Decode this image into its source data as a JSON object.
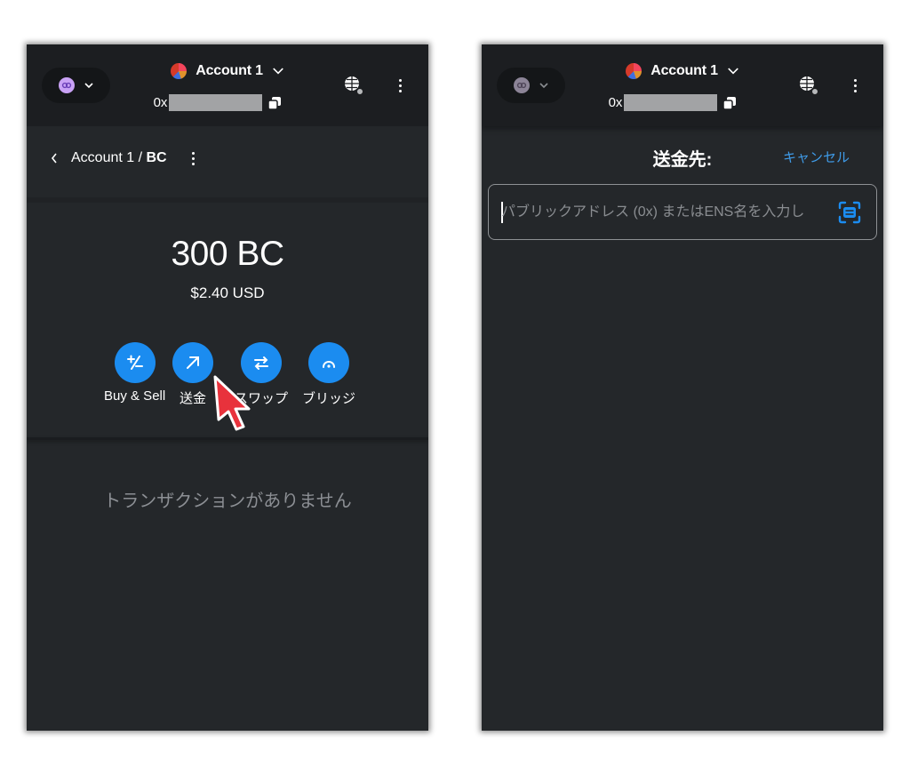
{
  "left_panel": {
    "header": {
      "network_icon": "network-icon",
      "account_name": "Account 1",
      "address_prefix": "0x",
      "address_masked": true
    },
    "breadcrumb": {
      "account": "Account 1 / ",
      "token": "BC"
    },
    "balance": {
      "amount": "300 BC",
      "fiat": "$2.40 USD"
    },
    "actions": [
      {
        "label": "Buy & Sell",
        "icon": "plus-minus-icon"
      },
      {
        "label": "送金",
        "icon": "arrow-up-right-icon"
      },
      {
        "label": "スワップ",
        "icon": "swap-icon"
      },
      {
        "label": "ブリッジ",
        "icon": "bridge-icon"
      }
    ],
    "empty_text": "トランザクションがありません"
  },
  "right_panel": {
    "header": {
      "account_name": "Account 1",
      "address_prefix": "0x",
      "address_masked": true
    },
    "title": "送金先:",
    "cancel_label": "キャンセル",
    "address_input": {
      "placeholder": "パブリックアドレス (0x) またはENS名を入力し",
      "value": ""
    }
  },
  "colors": {
    "background": "#24272a",
    "header": "#1c1e21",
    "accent": "#1b8cf0",
    "link": "#3f9be8",
    "cursor_arrow": "#e8323c"
  }
}
